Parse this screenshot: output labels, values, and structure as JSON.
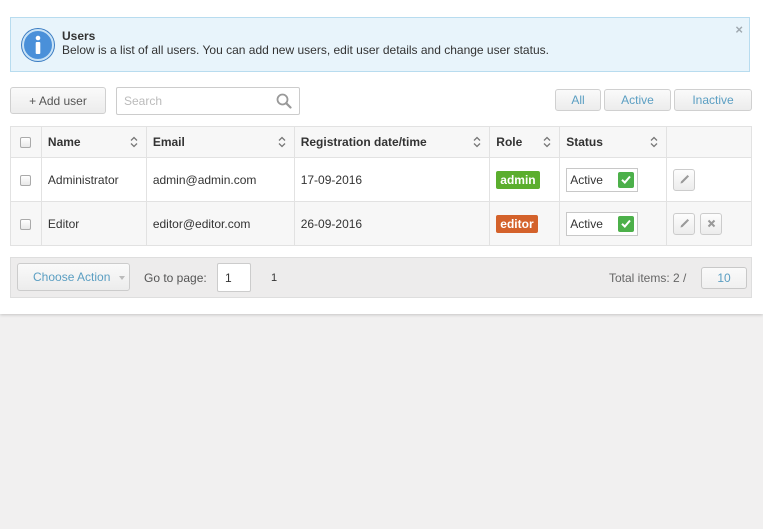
{
  "info": {
    "title": "Users",
    "text": "Below is a list of all users. You can add new users, edit user details and change user status.",
    "close": "×"
  },
  "toolbar": {
    "add_label": "+ Add user",
    "search_placeholder": "Search",
    "filters": [
      "All",
      "Active",
      "Inactive"
    ]
  },
  "table": {
    "columns": [
      "Name",
      "Email",
      "Registration date/time",
      "Role",
      "Status"
    ],
    "rows": [
      {
        "name": "Administrator",
        "email": "admin@admin.com",
        "date": "17-09-2016",
        "role": "admin",
        "status": "Active"
      },
      {
        "name": "Editor",
        "email": "editor@editor.com",
        "date": "26-09-2016",
        "role": "editor",
        "status": "Active"
      }
    ]
  },
  "footer": {
    "choose_action": "Choose Action",
    "goto_label": "Go to page:",
    "goto_value": "1",
    "page_number": "1",
    "total_label": "Total items: 2 /",
    "per_page": "10"
  },
  "colors": {
    "admin_badge": "#5bae2e",
    "editor_badge": "#d4622b",
    "status_check": "#4cb04a",
    "link_blue": "#5a9ec2"
  }
}
